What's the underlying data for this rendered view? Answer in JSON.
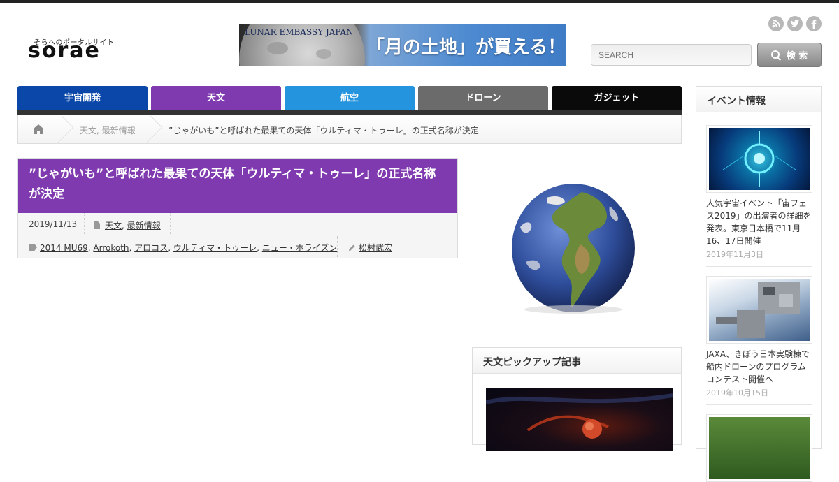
{
  "logo": {
    "tagline": "そらへのポータルサイト",
    "wordmark": "sorae"
  },
  "banner": {
    "brand": "LUNAR EMBASSY JAPAN",
    "headline": "「月の土地」が買える！"
  },
  "social": {
    "rss": "rss-icon",
    "twitter": "twitter-icon",
    "facebook": "facebook-icon"
  },
  "search": {
    "placeholder": "SEARCH",
    "button": "検 索"
  },
  "nav": [
    {
      "label": "宇宙開発",
      "color": "#0a47a8"
    },
    {
      "label": "天文",
      "color": "#7f3aaf"
    },
    {
      "label": "航空",
      "color": "#2394dd"
    },
    {
      "label": "ドローン",
      "color": "#6b6b6b"
    },
    {
      "label": "ガジェット",
      "color": "#0a0a0a"
    }
  ],
  "breadcrumb": {
    "categories": "天文, 最新情報",
    "current": "”じゃがいも”と呼ばれた最果ての天体「ウルティマ・トゥーレ」の正式名称が決定"
  },
  "article": {
    "title": "”じゃがいも”と呼ばれた最果ての天体「ウルティマ・トゥーレ」の正式名称が決定",
    "date": "2019/11/13",
    "categories": [
      "天文",
      "最新情報"
    ],
    "tags": [
      "2014 MU69",
      "Arrokoth",
      "アロコス",
      "ウルティマ・トゥーレ",
      "ニュー・ホライズン"
    ],
    "author": "松村武宏"
  },
  "pickup": {
    "title": "天文ピックアップ記事"
  },
  "sidebar": {
    "title": "イベント情報",
    "events": [
      {
        "text": "人気宇宙イベント「宙フェス2019」の出演者の詳細を発表。東京日本橋で11月16、17日開催",
        "date": "2019年11月3日"
      },
      {
        "text": "JAXA、きぼう日本実験棟で船内ドローンのプログラムコンテスト開催へ",
        "date": "2019年10月15日"
      }
    ]
  }
}
